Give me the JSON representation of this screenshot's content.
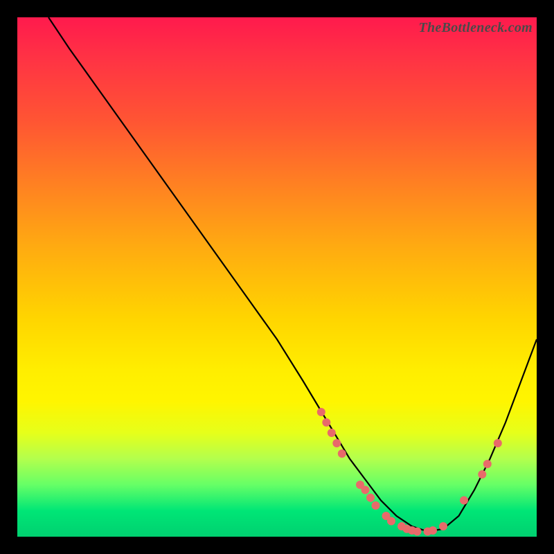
{
  "watermark": "TheBottleneck.com",
  "chart_data": {
    "type": "line",
    "title": "",
    "xlabel": "",
    "ylabel": "",
    "xlim": [
      0,
      100
    ],
    "ylim": [
      0,
      100
    ],
    "series": [
      {
        "name": "curve",
        "x": [
          6,
          10,
          15,
          20,
          25,
          30,
          35,
          40,
          45,
          50,
          55,
          58,
          61,
          64,
          67,
          70,
          73,
          76,
          79,
          82,
          85,
          88,
          91,
          94,
          97,
          100
        ],
        "y": [
          100,
          94,
          87,
          80,
          73,
          66,
          59,
          52,
          45,
          38,
          30,
          25,
          20,
          15,
          11,
          7,
          4,
          2,
          1,
          1.5,
          4,
          9,
          15,
          22,
          30,
          38
        ]
      }
    ],
    "markers": [
      {
        "x": 58.5,
        "y": 24
      },
      {
        "x": 59.5,
        "y": 22
      },
      {
        "x": 60.5,
        "y": 20
      },
      {
        "x": 61.5,
        "y": 18
      },
      {
        "x": 62.5,
        "y": 16
      },
      {
        "x": 66,
        "y": 10
      },
      {
        "x": 67,
        "y": 9
      },
      {
        "x": 68,
        "y": 7.5
      },
      {
        "x": 69,
        "y": 6
      },
      {
        "x": 71,
        "y": 4
      },
      {
        "x": 72,
        "y": 3
      },
      {
        "x": 74,
        "y": 2
      },
      {
        "x": 75,
        "y": 1.5
      },
      {
        "x": 76,
        "y": 1.2
      },
      {
        "x": 77,
        "y": 1
      },
      {
        "x": 79,
        "y": 1
      },
      {
        "x": 80,
        "y": 1.2
      },
      {
        "x": 82,
        "y": 2
      },
      {
        "x": 86,
        "y": 7
      },
      {
        "x": 89.5,
        "y": 12
      },
      {
        "x": 90.5,
        "y": 14
      },
      {
        "x": 92.5,
        "y": 18
      }
    ],
    "gradient_stops": [
      {
        "pos": 0,
        "color": "#ff1a4d"
      },
      {
        "pos": 50,
        "color": "#ffcc00"
      },
      {
        "pos": 75,
        "color": "#ffff33"
      },
      {
        "pos": 100,
        "color": "#00d070"
      }
    ]
  }
}
